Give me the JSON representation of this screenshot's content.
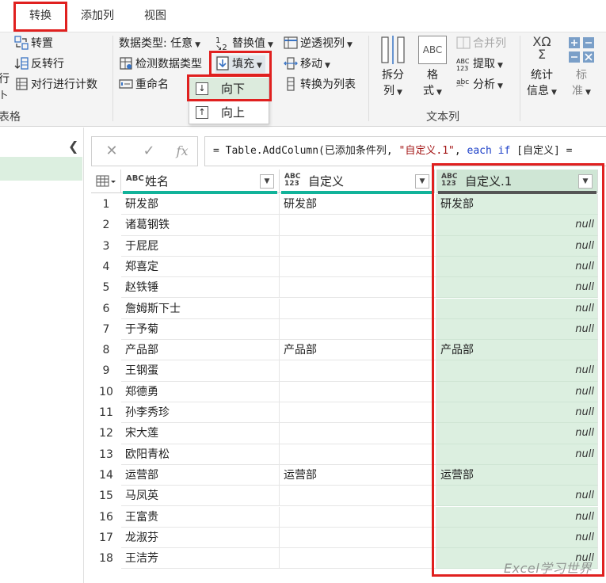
{
  "ribbon_tabs": {
    "left_fragment": "ﾠ",
    "items": [
      {
        "label": "转换",
        "active": true
      },
      {
        "label": "添加列",
        "active": false
      },
      {
        "label": "视图",
        "active": false
      }
    ]
  },
  "ribbon": {
    "table_group": {
      "transpose": "转置",
      "reverse_rows": "反转行",
      "count_rows": "对行进行计数",
      "cut_left_1": "行",
      "cut_left_2": "卜",
      "group_label": "表格"
    },
    "any_column_group": {
      "data_type": "数据类型: 任意",
      "detect_type": "检测数据类型",
      "rename": "重命名",
      "replace_values": "替换值",
      "fill": "填充",
      "pivot_column": "逆透视列",
      "move": "移动",
      "convert_to_list": "转换为列表"
    },
    "fill_menu": {
      "down": "向下",
      "up": "向上"
    },
    "text_column_group": {
      "split_column": "拆分\n列",
      "format": "格\n式",
      "merge_columns": "合并列",
      "extract": "提取",
      "parse": "分析",
      "group_label": "文本列",
      "abc_icon": "ABC"
    },
    "number_group": {
      "statistics": "统计\n信息",
      "standard": "标\n准",
      "sigma": "XΩ\nΣ"
    }
  },
  "formula_bar": {
    "cancel": "✕",
    "commit": "✓",
    "fx": "fx",
    "prefix": "= Table.AddColumn(已添加条件列, ",
    "string_arg": "\"自定义.1\"",
    "comma": ", ",
    "keyword": "each if",
    "suffix": " [自定义] ="
  },
  "grid": {
    "columns": [
      {
        "name": "姓名",
        "type": "ABC"
      },
      {
        "name": "自定义",
        "type": "ABC\n123"
      },
      {
        "name": "自定义.1",
        "type": "ABC\n123"
      }
    ],
    "rows": [
      [
        "研发部",
        "研发部",
        "研发部"
      ],
      [
        "诸葛钢铁",
        "",
        "null"
      ],
      [
        "于屁屁",
        "",
        "null"
      ],
      [
        "郑喜定",
        "",
        "null"
      ],
      [
        "赵铁锤",
        "",
        "null"
      ],
      [
        "詹姆斯下士",
        "",
        "null"
      ],
      [
        "于予菊",
        "",
        "null"
      ],
      [
        "产品部",
        "产品部",
        "产品部"
      ],
      [
        "王钢蛋",
        "",
        "null"
      ],
      [
        "郑德勇",
        "",
        "null"
      ],
      [
        "孙李秀珍",
        "",
        "null"
      ],
      [
        "宋大莲",
        "",
        "null"
      ],
      [
        "欧阳青松",
        "",
        "null"
      ],
      [
        "运营部",
        "运营部",
        "运营部"
      ],
      [
        "马凤英",
        "",
        "null"
      ],
      [
        "王富贵",
        "",
        "null"
      ],
      [
        "龙淑芬",
        "",
        "null"
      ],
      [
        "王洁芳",
        "",
        "null"
      ]
    ]
  },
  "watermark": "Excel学习世界",
  "colors": {
    "highlight_red": "#e0201f",
    "selected_column": "#dcefe0",
    "quality_bar": "#12b39a",
    "tab_underline": "#2d7d3a"
  }
}
